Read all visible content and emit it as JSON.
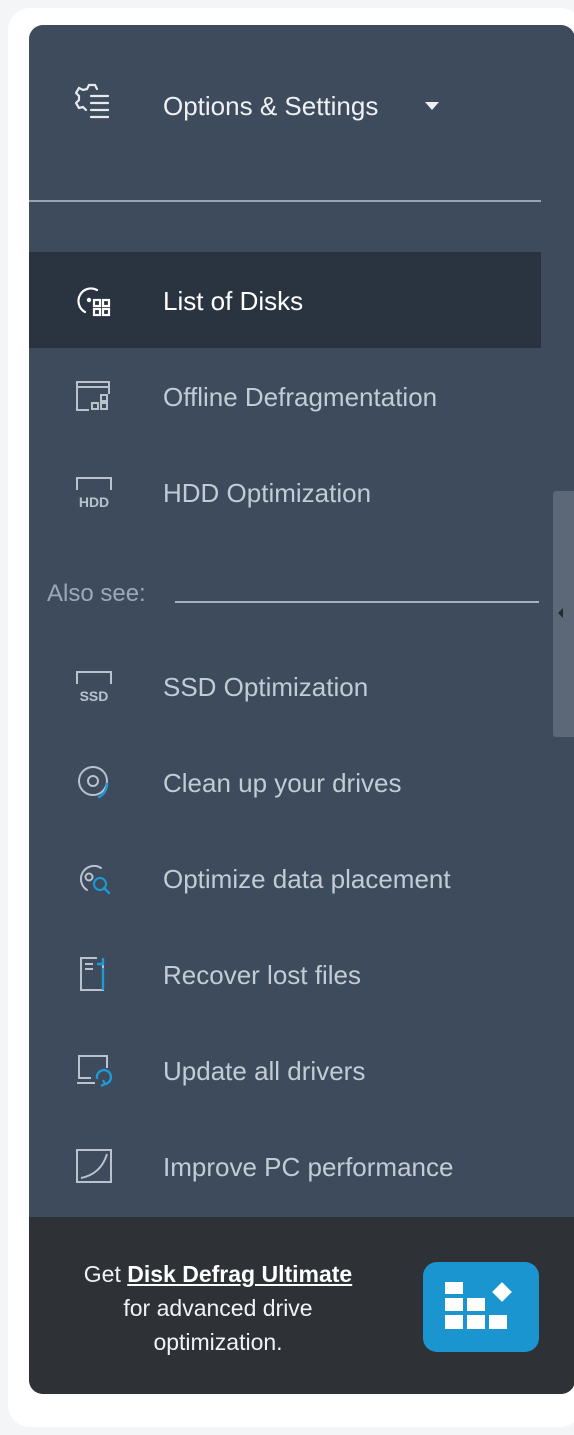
{
  "settings": {
    "label": "Options & Settings",
    "icon": "settings-list-icon"
  },
  "nav": {
    "items": [
      {
        "label": "List of Disks",
        "icon": "disk-list-icon",
        "active": true
      },
      {
        "label": "Offline Defragmentation",
        "icon": "offline-defrag-icon",
        "active": false
      },
      {
        "label": "HDD Optimization",
        "icon": "hdd-icon",
        "active": false
      }
    ]
  },
  "also_see": {
    "label": "Also see:",
    "items": [
      {
        "label": "SSD Optimization",
        "icon": "ssd-icon"
      },
      {
        "label": "Clean up your drives",
        "icon": "disc-icon"
      },
      {
        "label": "Optimize data placement",
        "icon": "disk-search-icon"
      },
      {
        "label": "Recover lost files",
        "icon": "file-recover-icon"
      },
      {
        "label": "Update all drivers",
        "icon": "driver-update-icon"
      },
      {
        "label": "Improve PC performance",
        "icon": "performance-icon"
      }
    ]
  },
  "promo": {
    "prefix": "Get ",
    "product": "Disk Defrag Ultimate",
    "suffix": " for advanced drive optimization.",
    "badge_icon": "disk-defrag-ultimate-icon"
  },
  "colors": {
    "panel": "#3d4b5d",
    "active_item": "#2a3441",
    "promo_bg": "#2e3237",
    "badge": "#1b95cf"
  }
}
